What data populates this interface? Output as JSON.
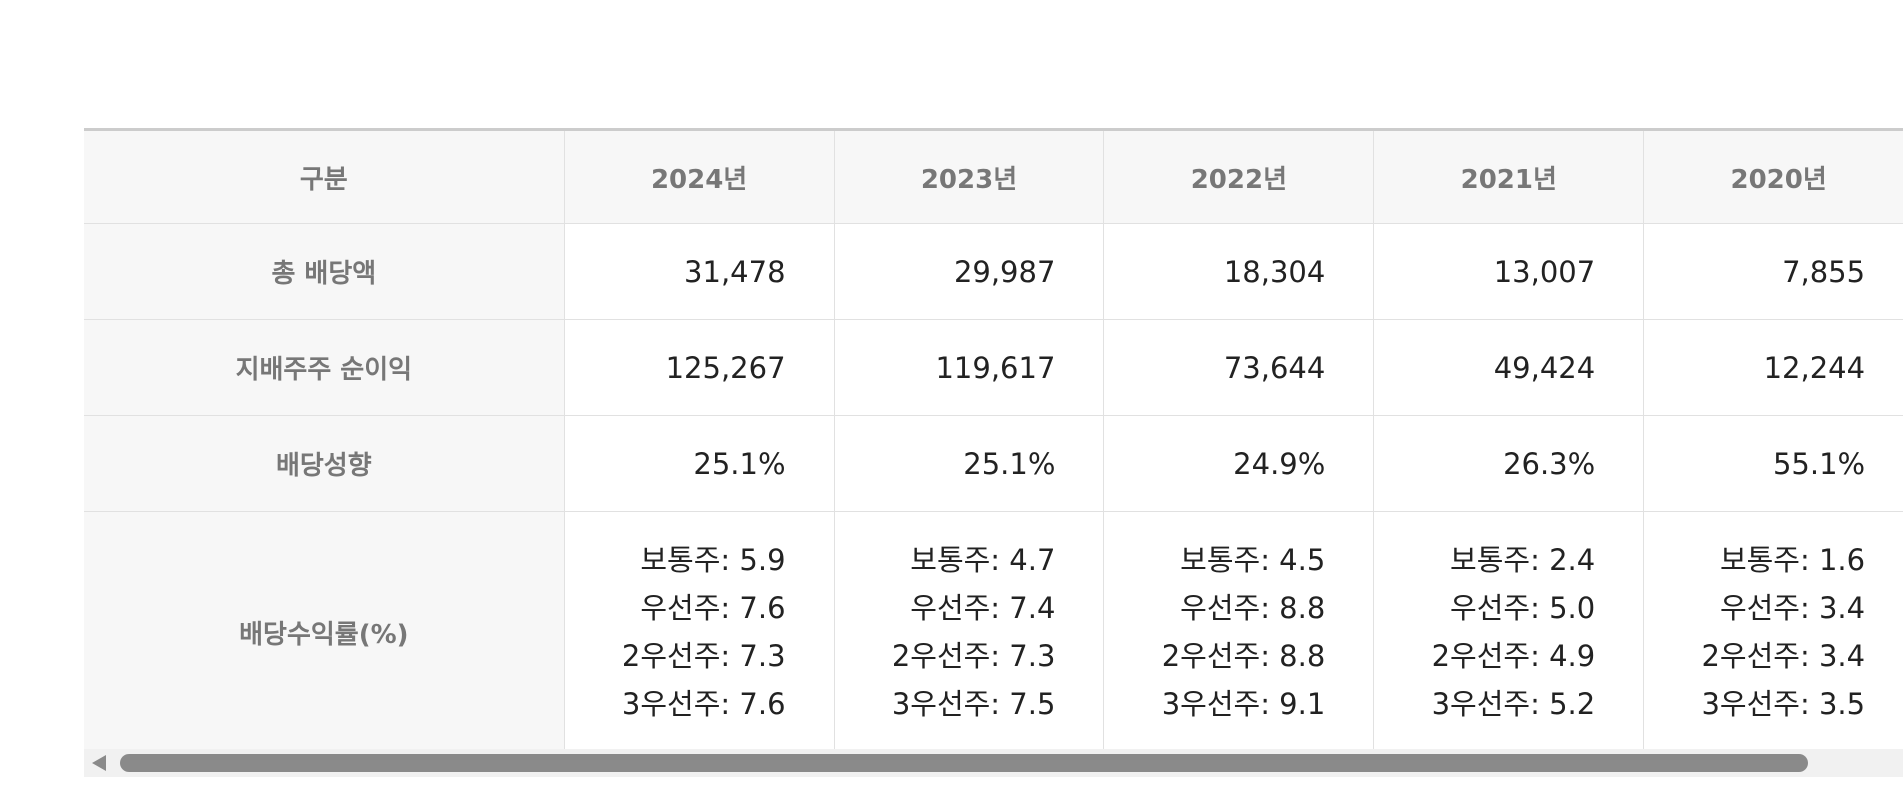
{
  "table": {
    "header": {
      "label": "구분",
      "years": [
        "2024년",
        "2023년",
        "2022년",
        "2021년",
        "2020년"
      ]
    },
    "rows": [
      {
        "label": "총 배당액",
        "values": [
          "31,478",
          "29,987",
          "18,304",
          "13,007",
          "7,855"
        ]
      },
      {
        "label": "지배주주 순이익",
        "values": [
          "125,267",
          "119,617",
          "73,644",
          "49,424",
          "12,244"
        ]
      },
      {
        "label": "배당성향",
        "values": [
          "25.1%",
          "25.1%",
          "24.9%",
          "26.3%",
          "55.1%"
        ]
      }
    ],
    "yield_row": {
      "label": "배당수익률(%)",
      "values": [
        [
          "보통주: 5.9",
          "우선주: 7.6",
          "2우선주: 7.3",
          "3우선주: 7.6"
        ],
        [
          "보통주: 4.7",
          "우선주: 7.4",
          "2우선주: 7.3",
          "3우선주: 7.5"
        ],
        [
          "보통주: 4.5",
          "우선주: 8.8",
          "2우선주: 8.8",
          "3우선주: 9.1"
        ],
        [
          "보통주: 2.4",
          "우선주: 5.0",
          "2우선주: 4.9",
          "3우선주: 5.2"
        ],
        [
          "보통주: 1.6",
          "우선주: 3.4",
          "2우선주: 3.4",
          "3우선주: 3.5"
        ]
      ]
    }
  },
  "scrollbar": {
    "arrow_icon": "triangle-left-icon",
    "thumb_color": "#8a8a8a"
  }
}
